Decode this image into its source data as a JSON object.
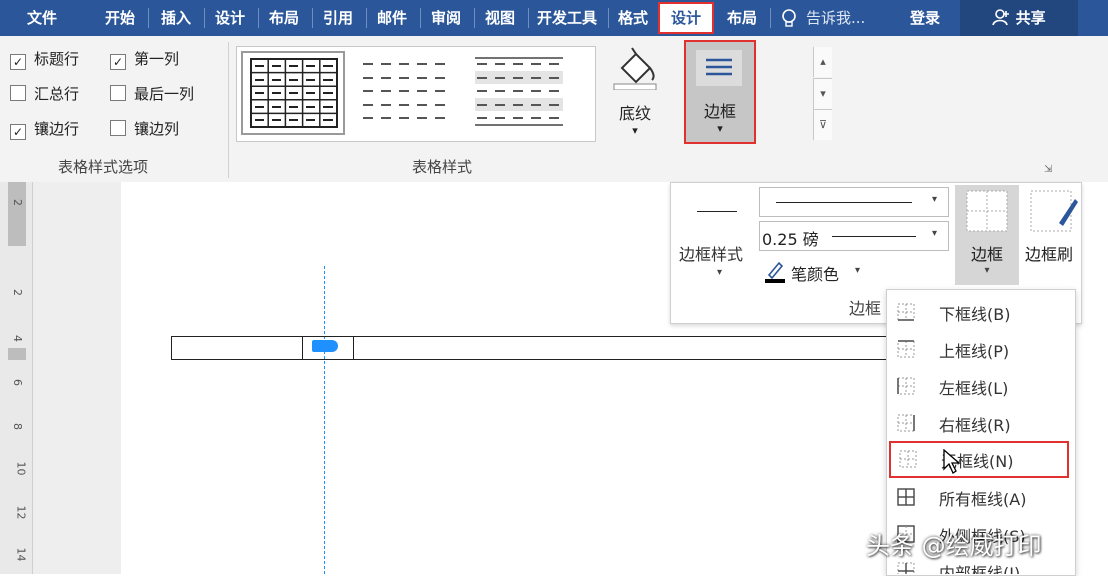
{
  "menubar": {
    "tabs": [
      "文件",
      "开始",
      "插入",
      "设计",
      "布局",
      "引用",
      "邮件",
      "审阅",
      "视图",
      "开发工具",
      "格式",
      "设计",
      "布局"
    ],
    "active_index": 11,
    "tell_me": "告诉我...",
    "login": "登录",
    "share": "共享"
  },
  "table_style_options": {
    "items": [
      {
        "label": "标题行",
        "checked": true
      },
      {
        "label": "第一列",
        "checked": true
      },
      {
        "label": "汇总行",
        "checked": false
      },
      {
        "label": "最后一列",
        "checked": false
      },
      {
        "label": "镶边行",
        "checked": true
      },
      {
        "label": "镶边列",
        "checked": false
      }
    ],
    "group_label": "表格样式选项"
  },
  "table_styles": {
    "group_label": "表格样式"
  },
  "shading": {
    "label": "底纹"
  },
  "borders_button": {
    "label": "边框"
  },
  "border_panel": {
    "style_label": "边框样式",
    "weight": "0.25 磅",
    "pen_color_label": "笔颜色",
    "borders_label": "边框",
    "painter_label": "边框刷",
    "group_label": "边框"
  },
  "ruler": {
    "numbers": [
      "2",
      "2",
      "4",
      "6",
      "8",
      "10",
      "12",
      "14"
    ]
  },
  "border_menu": {
    "items": [
      {
        "label": "下框线(B)",
        "icon": "bottom-border-icon"
      },
      {
        "label": "上框线(P)",
        "icon": "top-border-icon"
      },
      {
        "label": "左框线(L)",
        "icon": "left-border-icon"
      },
      {
        "label": "右框线(R)",
        "icon": "right-border-icon"
      },
      {
        "label": "无框线(N)",
        "icon": "no-border-icon"
      },
      {
        "label": "所有框线(A)",
        "icon": "all-borders-icon"
      },
      {
        "label": "外侧框线(S)",
        "icon": "outside-borders-icon"
      },
      {
        "label": "内部框线(I)",
        "icon": "inside-borders-icon"
      }
    ],
    "highlighted_index": 4
  },
  "watermark": "头条 @绘威打印",
  "colors": {
    "accent": "#2b579a",
    "highlight": "#e03030",
    "guide": "#1e90ff"
  }
}
